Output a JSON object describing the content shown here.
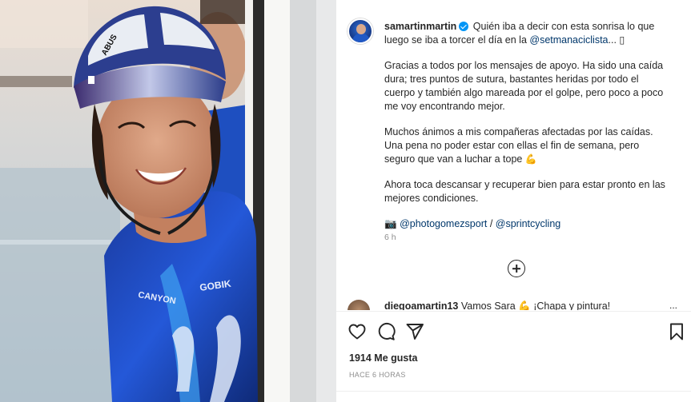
{
  "post": {
    "username": "samartinmartin",
    "verified": true,
    "caption_intro": " Quién iba a decir con esta sonrisa lo que luego se iba a torcer el día en la ",
    "caption_mention": "@setmanaciclista",
    "caption_intro_end": "... ▯",
    "paragraph_2": "Gracias a todos por los mensajes de apoyo. Ha sido una caída dura; tres puntos de sutura, bastantes heridas por todo el cuerpo y también algo mareada por el golpe, pero poco a poco me voy encontrando mejor.",
    "paragraph_3": "Muchos ánimos a mis compañeras afectadas por las caídas. Una pena no poder estar con ellas el fin de semana, pero seguro que van a luchar a tope",
    "paragraph_3_emoji": "💪",
    "paragraph_4": "Ahora toca descansar y recuperar bien para estar pronto en las mejores condiciones.",
    "credits_emoji": "📷",
    "credit_1": "@photogomezsport",
    "credit_sep": " / ",
    "credit_2": "@sprintcycling",
    "time_ago": "6 h"
  },
  "comment": {
    "username": "diegoamartin13",
    "text": " Vamos Sara 💪 ¡Chapa y pintura!",
    "more": "..."
  },
  "actions": {
    "like_icon": "heart-icon",
    "comment_icon": "comment-icon",
    "share_icon": "share-icon",
    "save_icon": "bookmark-icon",
    "load_more_icon": "plus-circle-icon"
  },
  "stats": {
    "likes": "1914 Me gusta",
    "posted_ago": "HACE 6 HORAS"
  },
  "photo": {
    "helmet_brand": "ABUS",
    "jersey_brand_1": "GOBIK",
    "jersey_brand_2": "CANYON"
  }
}
